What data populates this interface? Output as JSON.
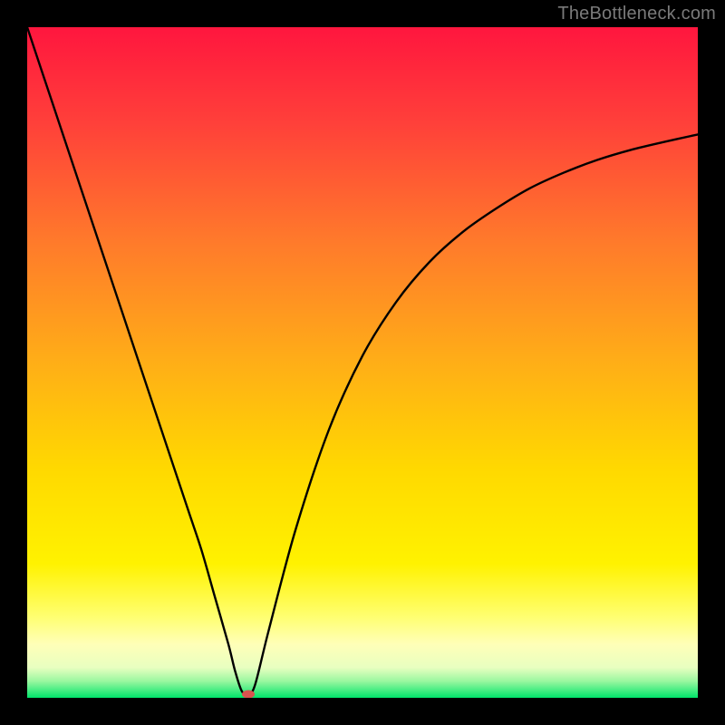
{
  "watermark": {
    "text": "TheBottleneck.com"
  },
  "colors": {
    "top": "#ff1a3c",
    "mid_upper": "#ff7a2b",
    "mid": "#ffd900",
    "lower_band": "#ffff9d",
    "green": "#00e46a",
    "curve": "#000000",
    "dot": "#d9534f",
    "bg": "#000000"
  },
  "chart_data": {
    "type": "line",
    "title": "",
    "xlabel": "",
    "ylabel": "",
    "xlim": [
      0,
      100
    ],
    "ylim": [
      0,
      100
    ],
    "x": [
      0,
      4,
      8,
      12,
      16,
      20,
      24,
      26,
      28,
      30,
      31,
      32,
      33,
      34,
      36,
      40,
      45,
      50,
      55,
      60,
      65,
      70,
      75,
      80,
      85,
      90,
      95,
      100
    ],
    "values": [
      100,
      88,
      76,
      64,
      52,
      40,
      28,
      22,
      15,
      8,
      4,
      1,
      0.5,
      2,
      10,
      25,
      40,
      51,
      59,
      65,
      69.5,
      73,
      76,
      78.3,
      80.2,
      81.7,
      82.9,
      84
    ],
    "marker": {
      "x": 33,
      "y": 0.5
    },
    "grid": false,
    "legend": false
  }
}
